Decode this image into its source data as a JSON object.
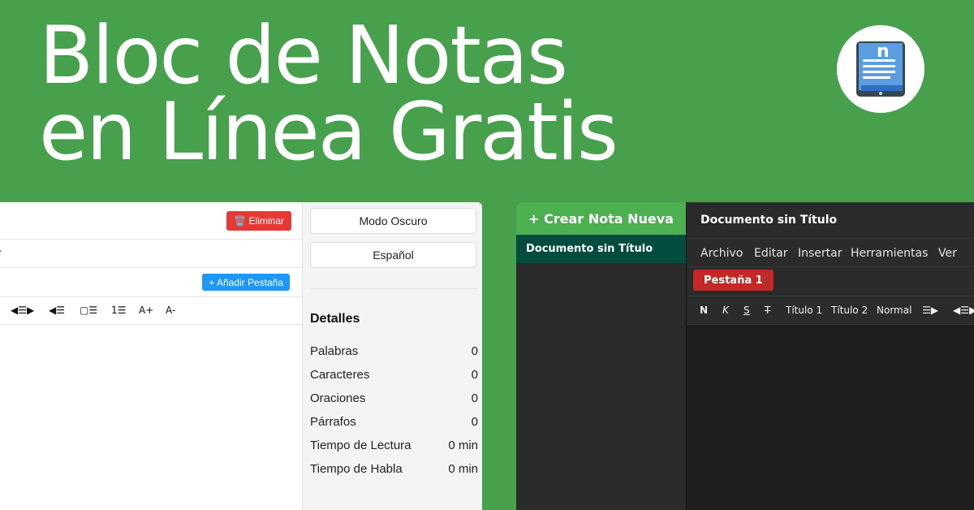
{
  "hero": {
    "title_line1": "Bloc de Notas",
    "title_line2": "en Línea Gratis",
    "logo_icon": "notebook-icon",
    "logo_letter": "n"
  },
  "light_panel": {
    "delete_label": "🗑️ Eliminar",
    "menu_fragment": "r",
    "add_tab_label": "+ Añadir Pestaña",
    "toolbar": [
      "◀☰▶",
      "◀☰",
      "▢☰",
      "1☰",
      "A+",
      "A-"
    ],
    "side": {
      "dark_mode_label": "Modo Oscuro",
      "language_label": "Español",
      "details_heading": "Detalles",
      "stats": [
        {
          "label": "Palabras",
          "value": "0"
        },
        {
          "label": "Caracteres",
          "value": "0"
        },
        {
          "label": "Oraciones",
          "value": "0"
        },
        {
          "label": "Párrafos",
          "value": "0"
        },
        {
          "label": "Tiempo de Lectura",
          "value": "0 min"
        },
        {
          "label": "Tiempo de Habla",
          "value": "0 min"
        }
      ]
    }
  },
  "dark_panel": {
    "create_note_label": "+ Crear Nota Nueva",
    "note_item": "Documento sin Título",
    "doc_title": "Documento sin Título",
    "menu": [
      "Archivo",
      "Editar",
      "Insertar",
      "Herramientas",
      "Ver"
    ],
    "tab_label": "Pestaña 1",
    "toolbar": [
      "N",
      "K",
      "S",
      "T",
      "Título 1",
      "Título 2",
      "Normal",
      "☰▶",
      "◀☰▶"
    ]
  },
  "colors": {
    "background": "#47a04b",
    "delete": "#e53935",
    "add_tab": "#2196f3",
    "create_note": "#4caf50",
    "note_item": "#004d40",
    "tab": "#c62828"
  }
}
